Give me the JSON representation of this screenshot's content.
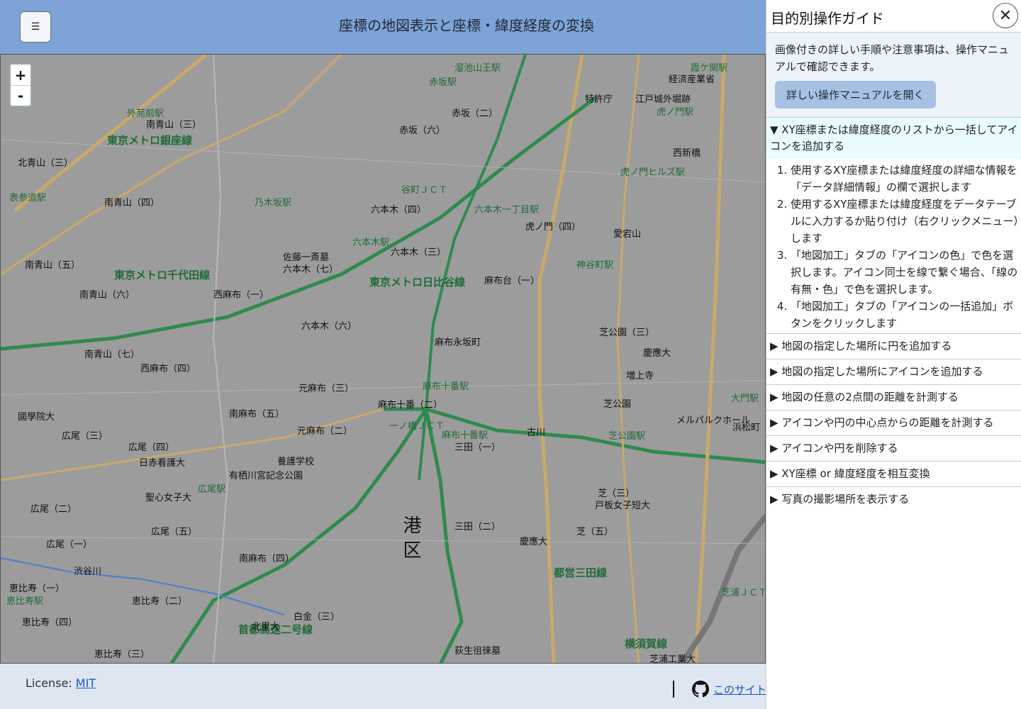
{
  "header": {
    "menu_icon": "☰",
    "title": "座標の地図表示と座標・緯度経度の変換"
  },
  "map": {
    "zoom_in": "+",
    "zoom_out": "-",
    "labels": [
      {
        "text": "東京メトロ銀座線",
        "cls": "line"
      },
      {
        "text": "東京メトロ千代田線",
        "cls": "line"
      },
      {
        "text": "外苑前駅",
        "cls": "station"
      },
      {
        "text": "南青山（三）",
        "cls": ""
      },
      {
        "text": "北青山（三）",
        "cls": ""
      },
      {
        "text": "表参道駅",
        "cls": "station"
      },
      {
        "text": "南青山（四）",
        "cls": ""
      },
      {
        "text": "乃木坂駅",
        "cls": "station"
      },
      {
        "text": "赤坂（六）",
        "cls": ""
      },
      {
        "text": "赤坂（二）",
        "cls": ""
      },
      {
        "text": "赤坂駅",
        "cls": "station"
      },
      {
        "text": "溜池山王駅",
        "cls": "station"
      },
      {
        "text": "特許庁",
        "cls": ""
      },
      {
        "text": "江戸城外堀跡",
        "cls": ""
      },
      {
        "text": "虎ノ門駅",
        "cls": "station"
      },
      {
        "text": "霞ケ関駅",
        "cls": "station"
      },
      {
        "text": "経済産業省",
        "cls": ""
      },
      {
        "text": "西新橋",
        "cls": ""
      },
      {
        "text": "虎ノ門ヒルズ駅",
        "cls": "station"
      },
      {
        "text": "谷町ＪＣＴ",
        "cls": "station"
      },
      {
        "text": "六本木一丁目駅",
        "cls": "station"
      },
      {
        "text": "六本木（四）",
        "cls": ""
      },
      {
        "text": "虎ノ門（四）",
        "cls": ""
      },
      {
        "text": "愛宕山",
        "cls": ""
      },
      {
        "text": "六本木駅",
        "cls": "station"
      },
      {
        "text": "六本木（三）",
        "cls": ""
      },
      {
        "text": "六本木（七）",
        "cls": ""
      },
      {
        "text": "佐藤一斎墓",
        "cls": ""
      },
      {
        "text": "東京メトロ日比谷線",
        "cls": "line"
      },
      {
        "text": "南青山（五）",
        "cls": ""
      },
      {
        "text": "南青山（六）",
        "cls": ""
      },
      {
        "text": "西麻布（一）",
        "cls": ""
      },
      {
        "text": "麻布台（一）",
        "cls": ""
      },
      {
        "text": "神谷町駅",
        "cls": "station"
      },
      {
        "text": "六本木（六）",
        "cls": ""
      },
      {
        "text": "麻布永坂町",
        "cls": ""
      },
      {
        "text": "芝公園（三）",
        "cls": ""
      },
      {
        "text": "慶應大",
        "cls": ""
      },
      {
        "text": "増上寺",
        "cls": ""
      },
      {
        "text": "南青山（七）",
        "cls": ""
      },
      {
        "text": "西麻布（四）",
        "cls": ""
      },
      {
        "text": "元麻布（三）",
        "cls": ""
      },
      {
        "text": "麻布十番駅",
        "cls": "station"
      },
      {
        "text": "麻布十番（二）",
        "cls": ""
      },
      {
        "text": "一ノ橋ＪＣＴ",
        "cls": "station"
      },
      {
        "text": "芝公園",
        "cls": ""
      },
      {
        "text": "芝公園駅",
        "cls": "station"
      },
      {
        "text": "メルパルクホール",
        "cls": ""
      },
      {
        "text": "國學院大",
        "cls": ""
      },
      {
        "text": "南麻布（五）",
        "cls": ""
      },
      {
        "text": "元麻布（二）",
        "cls": ""
      },
      {
        "text": "麻布十番駅",
        "cls": "station"
      },
      {
        "text": "三田（一）",
        "cls": ""
      },
      {
        "text": "古川",
        "cls": ""
      },
      {
        "text": "広尾（三）",
        "cls": ""
      },
      {
        "text": "広尾（四）",
        "cls": ""
      },
      {
        "text": "日赤看護大",
        "cls": ""
      },
      {
        "text": "養護学校",
        "cls": ""
      },
      {
        "text": "有栖川宮記念公園",
        "cls": ""
      },
      {
        "text": "広尾駅",
        "cls": "station"
      },
      {
        "text": "聖心女子大",
        "cls": ""
      },
      {
        "text": "広尾（二）",
        "cls": ""
      },
      {
        "text": "広尾（五）",
        "cls": ""
      },
      {
        "text": "三田（二）",
        "cls": ""
      },
      {
        "text": "慶應大",
        "cls": ""
      },
      {
        "text": "芝（三）",
        "cls": ""
      },
      {
        "text": "戸板女子短大",
        "cls": ""
      },
      {
        "text": "芝（五）",
        "cls": ""
      },
      {
        "text": "港",
        "cls": "big"
      },
      {
        "text": "区",
        "cls": "big"
      },
      {
        "text": "広尾（一）",
        "cls": ""
      },
      {
        "text": "南麻布（四）",
        "cls": ""
      },
      {
        "text": "渋谷川",
        "cls": ""
      },
      {
        "text": "都営三田線",
        "cls": "line"
      },
      {
        "text": "恵比寿（一）",
        "cls": ""
      },
      {
        "text": "恵比寿（二）",
        "cls": ""
      },
      {
        "text": "恵比寿駅",
        "cls": "station"
      },
      {
        "text": "首都高速二号線",
        "cls": "line"
      },
      {
        "text": "白金（三）",
        "cls": ""
      },
      {
        "text": "恵比寿（四）",
        "cls": ""
      },
      {
        "text": "北里大",
        "cls": ""
      },
      {
        "text": "恵比寿（三）",
        "cls": ""
      },
      {
        "text": "荻生徂徠墓",
        "cls": ""
      },
      {
        "text": "横須賀線",
        "cls": "line"
      },
      {
        "text": "芝浦工業大",
        "cls": ""
      },
      {
        "text": "芝浦ＪＣＴ",
        "cls": "station"
      },
      {
        "text": "大門駅",
        "cls": "station"
      },
      {
        "text": "浜松町",
        "cls": ""
      }
    ]
  },
  "footer": {
    "license_prefix": "License: ",
    "license_link": "MIT",
    "github_link": "このサイト"
  },
  "panel": {
    "title": "目的別操作ガイド",
    "close_icon": "✕",
    "intro_text": "画像付きの詳しい手順や注意事項は、操作マニュアルで確認できます。",
    "manual_button": "詳しい操作マニュアルを開く",
    "open_section": {
      "summary": "▼ XY座標または緯度経度のリストから一括してアイコンを追加する",
      "steps": [
        "使用するXY座標または緯度経度の詳細な情報を「データ詳細情報」の欄で選択します",
        "使用するXY座標または緯度経度をデータテーブルに入力するか貼り付け（右クリックメニュー）します",
        "「地図加工」タブの「アイコンの色」で色を選択します。アイコン同士を線で繋ぐ場合、「線の有無・色」で色を選択します。",
        "「地図加工」タブの「アイコンの一括追加」ボタンをクリックします"
      ]
    },
    "sections": [
      "▶ 地図の指定した場所に円を追加する",
      "▶ 地図の指定した場所にアイコンを追加する",
      "▶ 地図の任意の2点間の距離を計測する",
      "▶ アイコンや円の中心点からの距離を計測する",
      "▶ アイコンや円を削除する",
      "▶ XY座標 or 緯度経度を相互変換",
      "▶ 写真の撮影場所を表示する"
    ]
  }
}
